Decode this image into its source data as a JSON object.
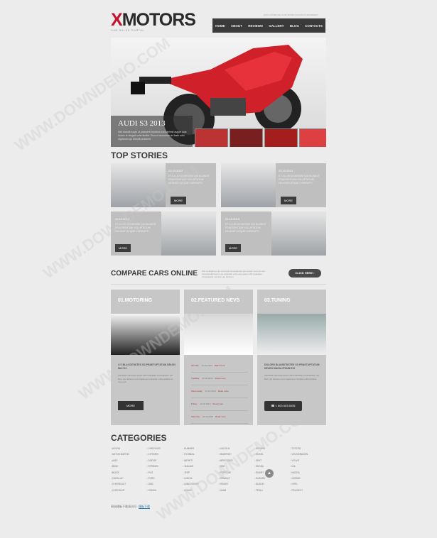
{
  "header": {
    "logo_x": "X",
    "logo_rest": "MOTORS",
    "tagline": "CAR SALES PORTAL",
    "topnote": "DUIS AUTEM VEL EUM IRIURE DOLOR IN HENDRERIT"
  },
  "nav": {
    "items": [
      "HOME",
      "ABOUT",
      "REVIEWS",
      "GALLERY",
      "BLOG",
      "CONTACTS"
    ]
  },
  "slider": {
    "title": "AUDI S3 2013",
    "text": "Sed blandit turpis ut praesent luptatum zzril delenit augue duis dolore te feugait nulla facilisi. Eros et accumsan et iusto odio dignissim qui blandit praesent."
  },
  "top_stories": {
    "heading": "TOP STORIES",
    "items": [
      {
        "date": "22.10.2013",
        "text": "ET ILLUM DIGNISSIM QUI BLANDIT PRAESENTIUM VOLUPTATUM DELENITI ATQUE CORRUPTI",
        "more": "MORE"
      },
      {
        "date": "22.10.2013",
        "text": "ET ILLUM DIGNISSIM QUI BLANDIT PRAESENTIUM VOLUPTATUM DELENITI ATQUE CORRUPTI",
        "more": "MORE"
      },
      {
        "date": "22.10.2013",
        "text": "ET ILLUM DIGNISSIM QUI BLANDIT PRAESENTIUM VOLUPTATUM DELENITI ATQUE CORRUPTI",
        "more": "MORE"
      },
      {
        "date": "22.10.2013",
        "text": "ET ILLUM DIGNISSIM QUI BLANDIT PRAESENTIUM VOLUPTATUM DELENITI ATQUE CORRUPTI",
        "more": "MORE"
      }
    ]
  },
  "compare": {
    "title": "COMPARE CARS ONLINE",
    "text": "Nisi ut aliquid ex ea commodi consequatur quis autem vel eum iure reprehenderit qui in ea voluptate velit esse quam nihil molestiae consequatur vel illum qui dolorem.",
    "button": "CLICK HERE ›"
  },
  "columns": {
    "motoring": {
      "title": "01.MOTORING",
      "head": "SIS BLANDITIISTES SS PRAETUPTATUM DELEN IMAGIA",
      "text": "Voluptate velit esse quam nihil molestiae consequatur, vel illum qui dolorem eum fugiat quo voluptas nulla pariatur at vero eos.",
      "button": "MORE"
    },
    "news": {
      "title": "02.FEATURED NEVS",
      "rows": [
        {
          "day": "Monday",
          "time": "22.10.2013",
          "link": "Read more"
        },
        {
          "day": "Tuesday",
          "time": "22.10.2013",
          "link": "Read more"
        },
        {
          "day": "Wednesday",
          "time": "22.10.2013",
          "link": "Read more"
        },
        {
          "day": "Friday",
          "time": "22.10.2013",
          "link": "Read more"
        },
        {
          "day": "Saturday",
          "time": "22.10.2013",
          "link": "Read more"
        }
      ]
    },
    "tuning": {
      "title": "03.TUNING",
      "head": "DOLORS BLANDITIISTES SS PRAETUPTATUM DELEN MAGIA IPSUM ECI",
      "text": "Voluptate velit esse quam nihil molestiae consequatur, vel illum qui dolorem eum fugiat quo voluptas nulla pariatur.",
      "phone": "1 800 603 6035"
    }
  },
  "categories": {
    "heading": "CATEGORIES",
    "columns": [
      [
        "ACURA",
        "ASTON MARTIN",
        "AUDI",
        "BMW",
        "BUICK",
        "CADILLAC",
        "CHEVROLET",
        "CHRYSLER"
      ],
      [
        "CHRYSLER",
        "CITROEN",
        "DODGE",
        "FERRARI",
        "FIAT",
        "FORD",
        "GMC",
        "HONDA"
      ],
      [
        "HUMMER",
        "HYUNDAI",
        "INFINITI",
        "JAGUAR",
        "JEEP",
        "LANCIA",
        "LAND ROVER",
        "LEXUS"
      ],
      [
        "LINCOLN",
        "MASERATI",
        "MERCEDES",
        "MINI",
        "PORSCHE",
        "RENAULT",
        "ROVER",
        "SAAB"
      ],
      [
        "SATURN",
        "SCION",
        "SEAT",
        "SKODA",
        "SMART",
        "SUBARU",
        "SUZUKI",
        "TESLA"
      ],
      [
        "TOYOTA",
        "VOLKSWAGEN",
        "VOLVO",
        "KIA",
        "MAZDA",
        "NISSAN",
        "OPEL",
        "PEUGEOT"
      ]
    ]
  },
  "footer": {
    "text": "网站模板下载请访问",
    "link": "模板下载"
  },
  "watermark": "WWW.DOWNDEMO.COM"
}
